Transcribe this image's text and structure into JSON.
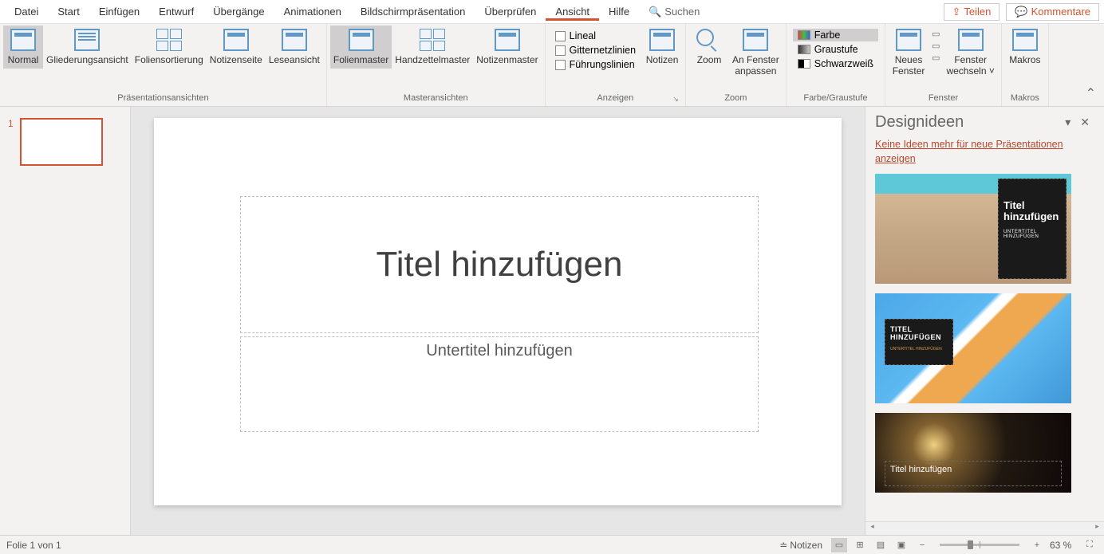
{
  "menu": {
    "items": [
      "Datei",
      "Start",
      "Einfügen",
      "Entwurf",
      "Übergänge",
      "Animationen",
      "Bildschirmpräsentation",
      "Überprüfen",
      "Ansicht",
      "Hilfe"
    ],
    "active_index": 8,
    "search_label": "Suchen",
    "share_label": "Teilen",
    "comments_label": "Kommentare"
  },
  "ribbon": {
    "groups": {
      "presentation_views": {
        "label": "Präsentationsansichten",
        "buttons": [
          "Normal",
          "Gliederungsansicht",
          "Foliensortierung",
          "Notizenseite",
          "Leseansicht"
        ]
      },
      "master_views": {
        "label": "Masteransichten",
        "buttons": [
          "Folienmaster",
          "Handzettelmaster",
          "Notizenmaster"
        ]
      },
      "show": {
        "label": "Anzeigen",
        "items": [
          "Lineal",
          "Gitternetzlinien",
          "Führungslinien"
        ],
        "notes_btn": "Notizen"
      },
      "zoom": {
        "label": "Zoom",
        "zoom_btn": "Zoom",
        "fit_btn": "An Fenster\nanpassen"
      },
      "color": {
        "label": "Farbe/Graustufe",
        "items": [
          "Farbe",
          "Graustufe",
          "Schwarzweiß"
        ]
      },
      "window": {
        "label": "Fenster",
        "new_window": "Neues\nFenster",
        "switch_window": "Fenster\nwechseln"
      },
      "macros": {
        "label": "Makros",
        "btn": "Makros"
      }
    }
  },
  "thumbs": {
    "slides": [
      {
        "num": "1"
      }
    ]
  },
  "slide": {
    "title_placeholder": "Titel hinzufügen",
    "subtitle_placeholder": "Untertitel hinzufügen"
  },
  "design_pane": {
    "title": "Designideen",
    "link": "Keine Ideen mehr für neue Präsentationen anzeigen",
    "ideas": [
      {
        "title": "Titel hinzufügen",
        "subtitle": "UNTERTITEL HINZUFÜGEN"
      },
      {
        "title": "TITEL HINZUFÜGEN",
        "subtitle": "UNTERTITEL HINZUFÜGEN"
      },
      {
        "title": "Titel hinzufügen"
      }
    ]
  },
  "statusbar": {
    "slide_info": "Folie 1 von 1",
    "notes_label": "Notizen",
    "zoom_pct": "63 %"
  }
}
